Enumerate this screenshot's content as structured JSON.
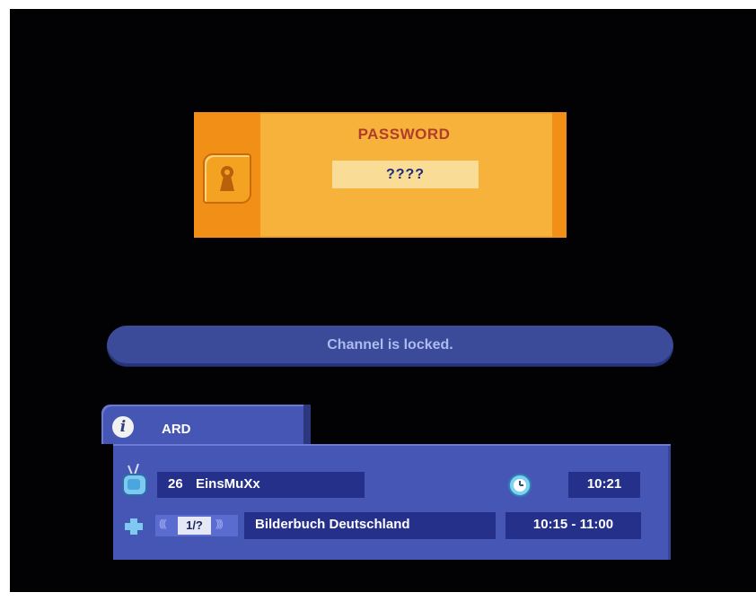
{
  "password_dialog": {
    "title": "PASSWORD",
    "input_value": "????"
  },
  "message": "Channel is locked.",
  "info_panel": {
    "channel_group": "ARD",
    "channel_number": "26",
    "channel_name": "EinsMuXx",
    "current_time": "10:21",
    "audio_track": "1/?",
    "program_title": "Bilderbuch Deutschland",
    "program_time": "10:15 - 11:00"
  },
  "icons": {
    "lock": "lock-icon",
    "info": "info-icon",
    "tv": "tv-icon",
    "alarm": "alarm-clock-icon",
    "plus": "plus-icon"
  },
  "colors": {
    "dialog_orange": "#f6b23a",
    "dialog_dark_orange": "#f28f16",
    "panel_blue": "#4656b4",
    "field_blue": "#24308a",
    "title_red": "#b23c2a"
  }
}
